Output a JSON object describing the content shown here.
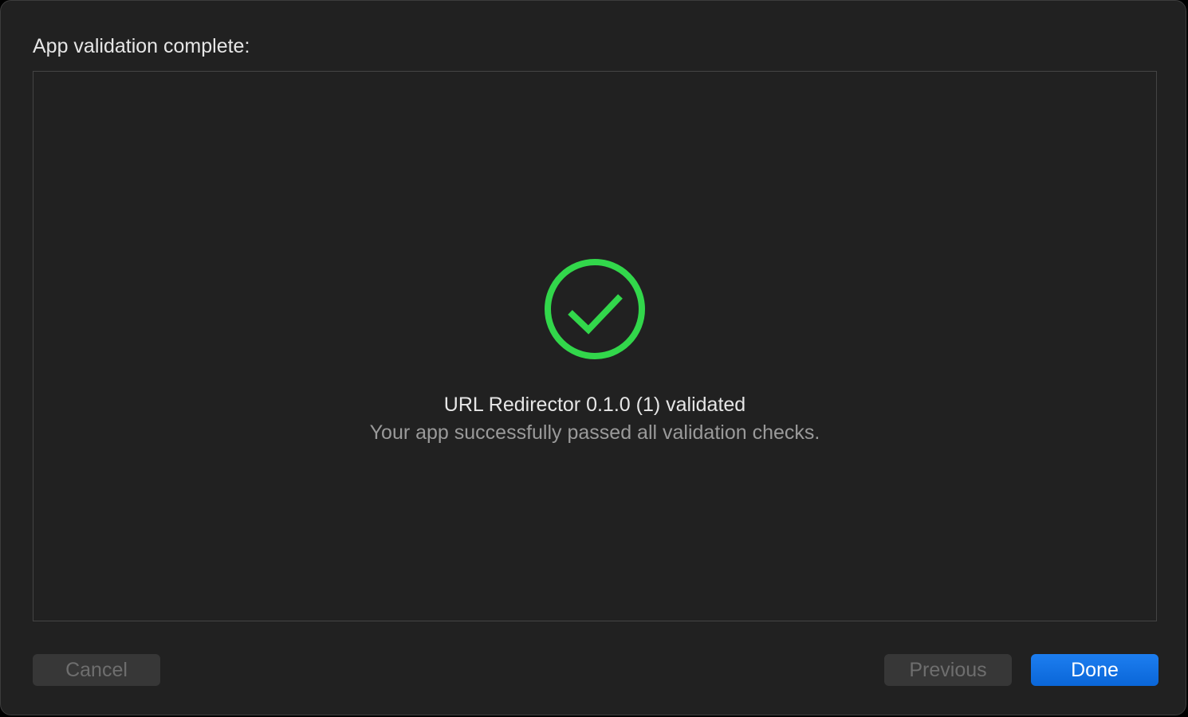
{
  "dialog": {
    "title": "App validation complete:"
  },
  "result": {
    "icon": "checkmark-circle-icon",
    "status_color": "#32d74b",
    "title": "URL Redirector 0.1.0 (1) validated",
    "detail": "Your app successfully passed all validation checks."
  },
  "buttons": {
    "cancel_label": "Cancel",
    "previous_label": "Previous",
    "done_label": "Done"
  },
  "colors": {
    "accent": "#0a84ff",
    "background": "#212121"
  }
}
